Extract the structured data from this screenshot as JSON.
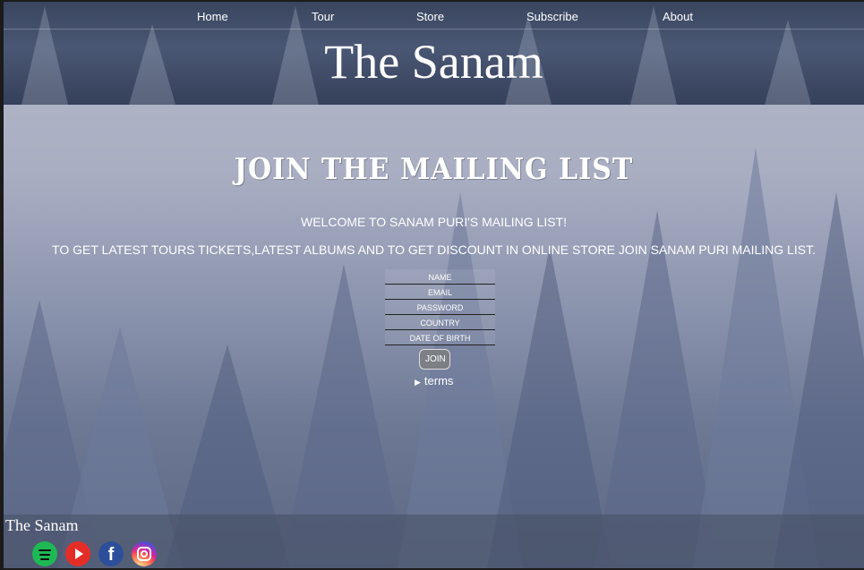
{
  "nav": {
    "items": [
      {
        "label": "Home"
      },
      {
        "label": "Tour"
      },
      {
        "label": "Store"
      },
      {
        "label": "Subscribe"
      },
      {
        "label": "About"
      }
    ]
  },
  "header": {
    "title": "The Sanam"
  },
  "main": {
    "heading": "JOIN THE MAILING LIST",
    "welcome": "WELCOME TO SANAM PURI'S MAILING LIST!",
    "promo": "TO GET LATEST TOURS TICKETS,LATEST ALBUMS AND TO GET DISCOUNT IN ONLINE STORE JOIN SANAM PURI MAILING LIST.",
    "form": {
      "name_placeholder": "NAME",
      "email_placeholder": "EMAIL",
      "password_placeholder": "PASSWORD",
      "country_placeholder": "COUNTRY",
      "dob_placeholder": "DATE OF BIRTH",
      "join_label": "JOIN",
      "terms_label": "terms"
    }
  },
  "footer": {
    "title": "The Sanam",
    "social": [
      {
        "icon": "spotify-icon",
        "color": "#1db954"
      },
      {
        "icon": "youtube-icon",
        "color": "#e52d27"
      },
      {
        "icon": "facebook-icon",
        "color": "#2d4f9b"
      },
      {
        "icon": "instagram-icon",
        "color": "#d6249f"
      }
    ]
  },
  "colors": {
    "header_bg": "#3a465f",
    "text": "#ffffff",
    "join_button_bg": "#7c7f84"
  }
}
